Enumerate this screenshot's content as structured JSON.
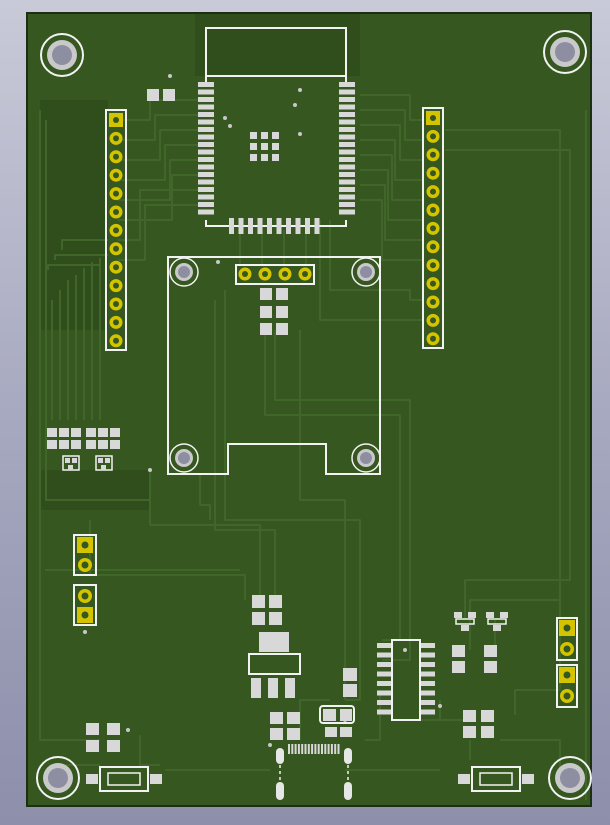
{
  "viewer": {
    "background_top": "#c9cad8",
    "background_bottom": "#8d8fab"
  },
  "board": {
    "substrate_color": "#2c4a1c",
    "copper_color": "#36571f",
    "pour_color": "#2f4e1c",
    "trace_color": "#416629",
    "pad_color": "#d8d8d8",
    "gold_color": "#d4c400",
    "silk_color": "#f2f2f2",
    "edge_color": "#1d2f12"
  },
  "components": [
    {
      "ref": "mounting-hole",
      "count": 4,
      "icon": "mounting-hole-icon"
    },
    {
      "ref": "esp32-module",
      "count": 1,
      "icon": "module-icon"
    },
    {
      "ref": "pin-header-1x13",
      "count": 2,
      "icon": "header-icon"
    },
    {
      "ref": "pin-header-1x4",
      "count": 1,
      "icon": "header-icon"
    },
    {
      "ref": "pin-header-1x2",
      "count": 4,
      "icon": "header-icon"
    },
    {
      "ref": "display-outline",
      "count": 1,
      "icon": "outline-icon"
    },
    {
      "ref": "voltage-regulator",
      "count": 1,
      "icon": "sot223-icon"
    },
    {
      "ref": "ic-soic16",
      "count": 1,
      "icon": "soic-icon"
    },
    {
      "ref": "usb-c-connector",
      "count": 1,
      "icon": "usb-icon"
    },
    {
      "ref": "tactile-switch",
      "count": 2,
      "icon": "switch-icon"
    }
  ]
}
